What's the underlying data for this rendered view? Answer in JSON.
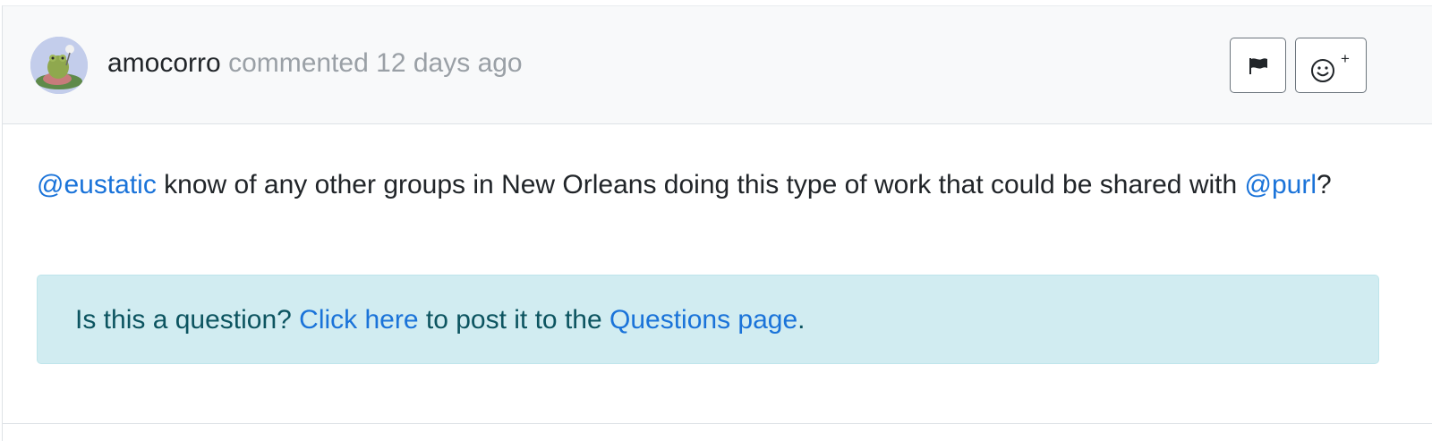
{
  "comment": {
    "author": "amocorro",
    "action": "commented",
    "time": "12 days ago",
    "avatar_icon": "frog-on-lilypad-avatar",
    "actions": {
      "flag_icon": "flag-icon",
      "reaction_icon": "smiley-icon",
      "reaction_plus": "+"
    },
    "body": {
      "mention1": "@eustatic",
      "text1": " know of any other groups in New Orleans doing this type of work that could be shared with ",
      "mention2": "@purl",
      "text2": "?"
    },
    "question_box": {
      "prefix": "Is this a question? ",
      "link1": "Click here",
      "middle": " to post it to the ",
      "link2": "Questions page",
      "suffix": "."
    }
  },
  "colors": {
    "link": "#1a73d9",
    "header_bg": "#f8f9fa",
    "info_bg": "#d1ecf1",
    "info_text": "#0c5460",
    "muted": "#9aa0a6"
  }
}
